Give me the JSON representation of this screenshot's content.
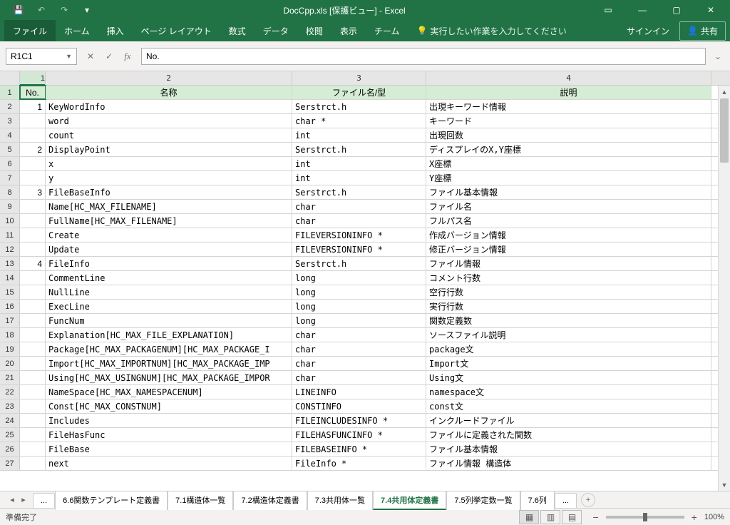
{
  "title": "DocCpp.xls [保護ビュー] - Excel",
  "qat": {
    "save": "💾",
    "undo": "↶",
    "redo": "↷"
  },
  "ribbon": {
    "tabs": [
      "ファイル",
      "ホーム",
      "挿入",
      "ページ レイアウト",
      "数式",
      "データ",
      "校閲",
      "表示",
      "チーム"
    ],
    "tell": "実行したい作業を入力してください",
    "signin": "サインイン",
    "share": "共有"
  },
  "formula": {
    "name_box": "R1C1",
    "value": "No."
  },
  "columns": {
    "c1_num": "1",
    "c2_num": "2",
    "c3_num": "3",
    "c4_num": "4"
  },
  "headers": {
    "no": "No.",
    "name": "名称",
    "file_type": "ファイル名/型",
    "desc": "説明"
  },
  "rows": [
    {
      "r": 2,
      "no": "1",
      "name": "KeyWordInfo",
      "type": "Serstrct.h",
      "desc": "出現キーワード情報"
    },
    {
      "r": 3,
      "no": "",
      "name": "word",
      "type": "char *",
      "desc": "キーワード"
    },
    {
      "r": 4,
      "no": "",
      "name": "count",
      "type": "int",
      "desc": "出現回数"
    },
    {
      "r": 5,
      "no": "2",
      "name": "DisplayPoint",
      "type": "Serstrct.h",
      "desc": "ディスプレイのX,Y座標"
    },
    {
      "r": 6,
      "no": "",
      "name": "x",
      "type": "int",
      "desc": "X座標"
    },
    {
      "r": 7,
      "no": "",
      "name": "y",
      "type": "int",
      "desc": "Y座標"
    },
    {
      "r": 8,
      "no": "3",
      "name": "FileBaseInfo",
      "type": "Serstrct.h",
      "desc": "ファイル基本情報"
    },
    {
      "r": 9,
      "no": "",
      "name": "Name[HC_MAX_FILENAME]",
      "type": "char",
      "desc": "ファイル名"
    },
    {
      "r": 10,
      "no": "",
      "name": "FullName[HC_MAX_FILENAME]",
      "type": "char",
      "desc": "フルパス名"
    },
    {
      "r": 11,
      "no": "",
      "name": "Create",
      "type": "FILEVERSIONINFO *",
      "desc": "作成バージョン情報"
    },
    {
      "r": 12,
      "no": "",
      "name": "Update",
      "type": "FILEVERSIONINFO *",
      "desc": "修正バージョン情報"
    },
    {
      "r": 13,
      "no": "4",
      "name": "FileInfo",
      "type": "Serstrct.h",
      "desc": "ファイル情報"
    },
    {
      "r": 14,
      "no": "",
      "name": "CommentLine",
      "type": "long",
      "desc": "コメント行数"
    },
    {
      "r": 15,
      "no": "",
      "name": "NullLine",
      "type": "long",
      "desc": "空行行数"
    },
    {
      "r": 16,
      "no": "",
      "name": "ExecLine",
      "type": "long",
      "desc": "実行行数"
    },
    {
      "r": 17,
      "no": "",
      "name": "FuncNum",
      "type": "long",
      "desc": "関数定義数"
    },
    {
      "r": 18,
      "no": "",
      "name": "Explanation[HC_MAX_FILE_EXPLANATION]",
      "type": "char",
      "desc": "ソースファイル説明"
    },
    {
      "r": 19,
      "no": "",
      "name": "Package[HC_MAX_PACKAGENUM][HC_MAX_PACKAGE_I",
      "type": "char",
      "desc": "package文"
    },
    {
      "r": 20,
      "no": "",
      "name": "Import[HC_MAX_IMPORTNUM][HC_MAX_PACKAGE_IMP",
      "type": "char",
      "desc": "Import文"
    },
    {
      "r": 21,
      "no": "",
      "name": "Using[HC_MAX_USINGNUM][HC_MAX_PACKAGE_IMPOR",
      "type": "char",
      "desc": "Using文"
    },
    {
      "r": 22,
      "no": "",
      "name": "NameSpace[HC_MAX_NAMESPACENUM]",
      "type": "LINEINFO",
      "desc": "namespace文"
    },
    {
      "r": 23,
      "no": "",
      "name": "Const[HC_MAX_CONSTNUM]",
      "type": "CONSTINFO",
      "desc": "const文"
    },
    {
      "r": 24,
      "no": "",
      "name": "Includes",
      "type": "FILEINCLUDESINFO *",
      "desc": "インクルードファイル"
    },
    {
      "r": 25,
      "no": "",
      "name": "FileHasFunc",
      "type": "FILEHASFUNCINFO *",
      "desc": "ファイルに定義された関数"
    },
    {
      "r": 26,
      "no": "",
      "name": "FileBase",
      "type": "FILEBASEINFO *",
      "desc": "ファイル基本情報"
    },
    {
      "r": 27,
      "no": "",
      "name": "next",
      "type": "FileInfo *",
      "desc": "ファイル情報 構造体"
    }
  ],
  "sheets": {
    "more_left": "...",
    "tabs": [
      "6.6関数テンプレート定義書",
      "7.1構造体一覧",
      "7.2構造体定義書",
      "7.3共用体一覧",
      "7.4共用体定義書",
      "7.5列挙定数一覧",
      "7.6列"
    ],
    "more_right": "...",
    "active_index": 4
  },
  "status": {
    "ready": "準備完了",
    "zoom": "100%"
  }
}
